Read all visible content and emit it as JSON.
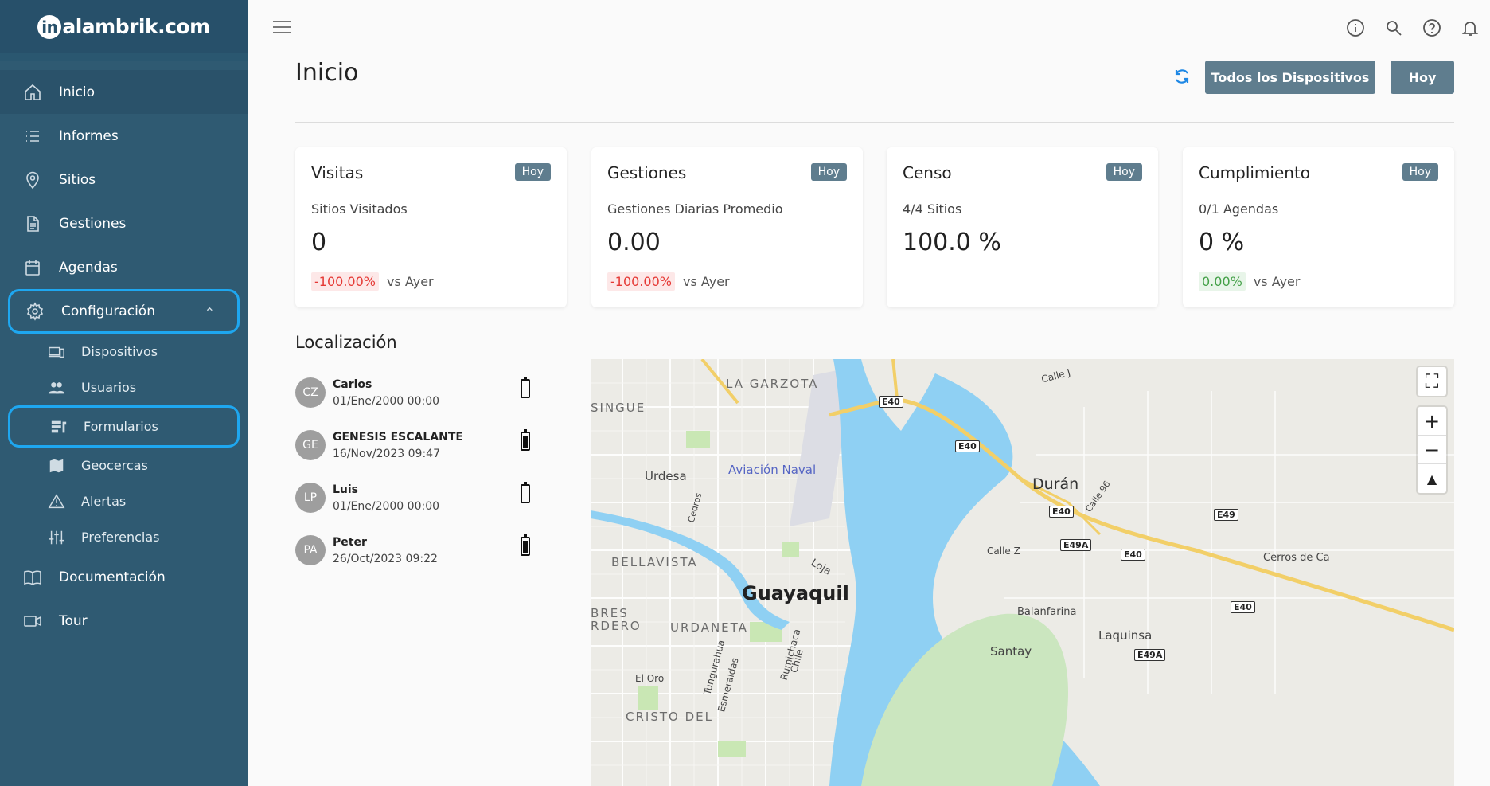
{
  "brand": {
    "logo_char": "in",
    "logo_rest": "alambrik.com"
  },
  "sidebar": {
    "items": [
      {
        "label": "Inicio",
        "icon": "home-icon"
      },
      {
        "label": "Informes",
        "icon": "list-icon"
      },
      {
        "label": "Sitios",
        "icon": "location-pin-icon"
      },
      {
        "label": "Gestiones",
        "icon": "document-icon"
      },
      {
        "label": "Agendas",
        "icon": "calendar-icon"
      },
      {
        "label": "Configuración",
        "icon": "gear-icon"
      }
    ],
    "subitems": [
      {
        "label": "Dispositivos",
        "icon": "devices-icon"
      },
      {
        "label": "Usuarios",
        "icon": "users-icon"
      },
      {
        "label": "Formularios",
        "icon": "forms-icon"
      },
      {
        "label": "Geocercas",
        "icon": "map-icon"
      },
      {
        "label": "Alertas",
        "icon": "warning-icon"
      },
      {
        "label": "Preferencias",
        "icon": "sliders-icon"
      }
    ],
    "bottom": [
      {
        "label": "Documentación",
        "icon": "book-icon"
      },
      {
        "label": "Tour",
        "icon": "video-camera-icon"
      }
    ]
  },
  "header": {
    "title": "Inicio",
    "devices_button": "Todos los Dispositivos",
    "today_button": "Hoy"
  },
  "cards": [
    {
      "title": "Visitas",
      "badge": "Hoy",
      "subtitle": "Sitios Visitados",
      "value": "0",
      "delta": "-100.00%",
      "delta_label": "vs Ayer"
    },
    {
      "title": "Gestiones",
      "badge": "Hoy",
      "subtitle": "Gestiones Diarias Promedio",
      "value": "0.00",
      "delta": "-100.00%",
      "delta_label": "vs Ayer"
    },
    {
      "title": "Censo",
      "badge": "Hoy",
      "subtitle": "4/4 Sitios",
      "value": "100.0 %"
    },
    {
      "title": "Cumplimiento",
      "badge": "Hoy",
      "subtitle": "0/1 Agendas",
      "value": "0 %",
      "delta": "0.00%",
      "delta_label": "vs Ayer"
    }
  ],
  "location": {
    "title": "Localización",
    "devices": [
      {
        "initials": "CZ",
        "name": "Carlos",
        "date": "01/Ene/2000 00:00",
        "battery": 0
      },
      {
        "initials": "GE",
        "name": "GENESIS ESCALANTE",
        "date": "16/Nov/2023 09:47",
        "battery": 0.8
      },
      {
        "initials": "LP",
        "name": "Luis",
        "date": "01/Ene/2000 00:00",
        "battery": 0
      },
      {
        "initials": "PA",
        "name": "Peter",
        "date": "26/Oct/2023 09:22",
        "battery": 0.8
      }
    ]
  },
  "map": {
    "labels": {
      "guayaquil": "Guayaquil",
      "duran": "Durán",
      "aviacion": "Aviación Naval",
      "garzota": "LA GARZOTA",
      "singue": "SINGUE",
      "urdesa": "Urdesa",
      "cedros": "Cedros",
      "bellavista": "BELLAVISTA",
      "bres": "BRES",
      "rdero": "RDERO",
      "urdaneta": "URDANETA",
      "loja": "Loja",
      "calle_j": "Calle J",
      "calle_z": "Calle Z",
      "calle_96": "Calle 96",
      "balanfarina": "Balanfarina",
      "laquinsa": "Laquinsa",
      "santay": "Santay",
      "cerros": "Cerros de Ca",
      "el_oro": "El Oro",
      "tungurahua": "Tungurahua",
      "esmeraldas": "Esmeraldas",
      "rumichaca": "Rumichaca",
      "chile": "Chile",
      "cristo": "CRISTO DEL"
    },
    "shields": [
      "E40",
      "E40",
      "E40",
      "E40",
      "E40",
      "E49",
      "E49A",
      "E49A"
    ]
  },
  "colors": {
    "sidebar": "#2f5a72",
    "accent": "#1ea7f0",
    "button": "#5f7d8e",
    "negative": "#e53935",
    "positive": "#43a047",
    "water": "#8fd0f3"
  }
}
